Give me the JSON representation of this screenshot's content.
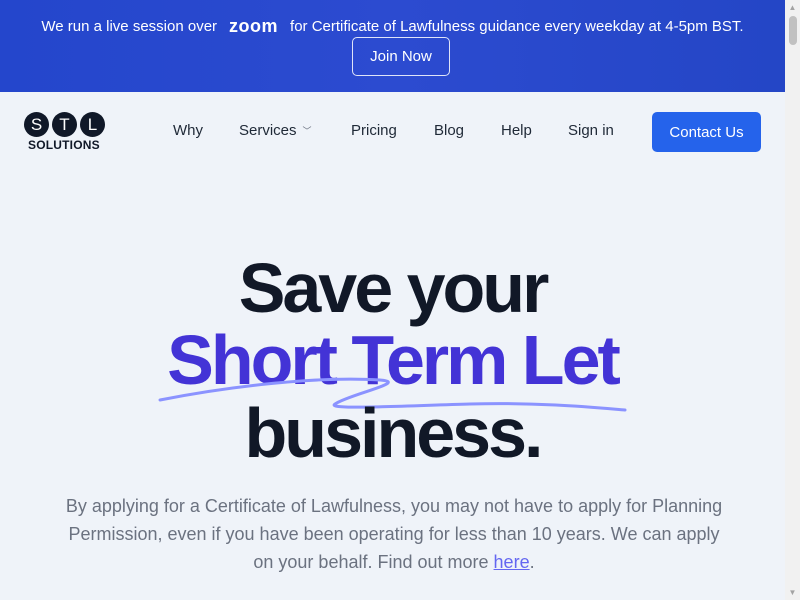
{
  "banner": {
    "text_before": "We run a live session over",
    "zoom_logo": "zoom",
    "text_after": "for Certificate of Lawfulness guidance every weekday at 4-5pm BST.",
    "join_button": "Join Now"
  },
  "nav": {
    "logo_letters": [
      "S",
      "T",
      "L"
    ],
    "logo_sub": "SOLUTIONS",
    "links": [
      "Why",
      "Services",
      "Pricing",
      "Blog",
      "Help",
      "Sign in"
    ],
    "contact_button": "Contact Us"
  },
  "hero": {
    "line1": "Save your",
    "line2": "Short Term Let",
    "line3": "business."
  },
  "description": {
    "text": "By applying for a Certificate of Lawfulness, you may not have to apply for Planning Permission, even if you have been operating for less than 10 years. We can apply on your behalf. Find out more",
    "link": "here",
    "end": "."
  },
  "colors": {
    "banner_blue": "#2446cc",
    "accent_blue": "#2563eb",
    "hero_purple": "#4333d6",
    "underline": "#8b93ff"
  }
}
